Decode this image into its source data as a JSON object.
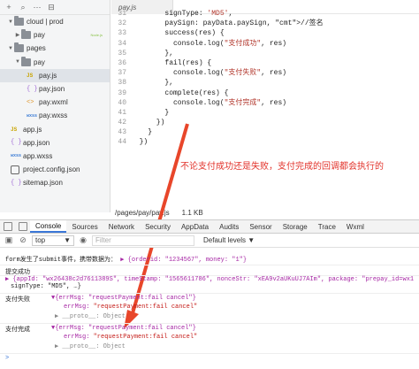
{
  "sidebar": {
    "items": [
      {
        "label": "cloud | prod",
        "kind": "folder",
        "caret": "▼",
        "indent": 8
      },
      {
        "label": "pay",
        "kind": "folder",
        "caret": "▶",
        "indent": 16,
        "tag": "Node.js"
      },
      {
        "label": "pages",
        "kind": "folder",
        "caret": "▼",
        "indent": 8
      },
      {
        "label": "pay",
        "kind": "folder",
        "caret": "▼",
        "indent": 16
      },
      {
        "label": "pay.js",
        "kind": "js",
        "badge": "JS",
        "indent": 30,
        "selected": true
      },
      {
        "label": "pay.json",
        "kind": "json",
        "badge": "{ }",
        "indent": 30
      },
      {
        "label": "pay.wxml",
        "kind": "wxml",
        "badge": "<>",
        "indent": 30
      },
      {
        "label": "pay.wxss",
        "kind": "wxss",
        "badge": "wxss",
        "indent": 30
      },
      {
        "label": "app.js",
        "kind": "js",
        "badge": "JS",
        "indent": 12
      },
      {
        "label": "app.json",
        "kind": "json",
        "badge": "{ }",
        "indent": 12
      },
      {
        "label": "app.wxss",
        "kind": "wxss",
        "badge": "wxss",
        "indent": 12
      },
      {
        "label": "project.config.json",
        "kind": "cfg",
        "badge": "",
        "indent": 12
      },
      {
        "label": "sitemap.json",
        "kind": "json",
        "badge": "{ }",
        "indent": 12
      }
    ]
  },
  "editor": {
    "tab_label": "pay.js",
    "lines": [
      {
        "n": "31",
        "t": "        signType: 'MD5',"
      },
      {
        "n": "32",
        "t": "        paySign: payData.paySign, //签名"
      },
      {
        "n": "33",
        "t": "        success(res) {"
      },
      {
        "n": "34",
        "t": "          console.log(\"支付成功\", res)"
      },
      {
        "n": "35",
        "t": "        },"
      },
      {
        "n": "36",
        "t": "        fail(res) {"
      },
      {
        "n": "37",
        "t": "          console.log(\"支付失败\", res)"
      },
      {
        "n": "38",
        "t": "        },"
      },
      {
        "n": "39",
        "t": "        complete(res) {"
      },
      {
        "n": "40",
        "t": "          console.log(\"支付完成\", res)"
      },
      {
        "n": "41",
        "t": "        }"
      },
      {
        "n": "42",
        "t": "      })"
      },
      {
        "n": "43",
        "t": "    }"
      },
      {
        "n": "44",
        "t": "  })"
      }
    ],
    "status_path": "/pages/pay/pay.js",
    "status_size": "1.1 KB"
  },
  "annotation": "不论支付成功还是失败，支付完成的回调都会执行的",
  "devtools": {
    "tabs": [
      "Console",
      "Sources",
      "Network",
      "Security",
      "AppData",
      "Audits",
      "Sensor",
      "Storage",
      "Trace",
      "Wxml"
    ],
    "active_tab": "Console",
    "context": "top",
    "filter_placeholder": "Filter",
    "levels": "Default levels ▼"
  },
  "console": {
    "line1_prefix": "form发生了submit事件，携带数据为：",
    "line1_obj": "▶ {orderid: \"1234567\", money: \"1\"}",
    "line2": "提交成功",
    "line3": "▶ {appId: \"wx26438c2d7611389S\", timeStamp: \"1565611786\", nonceStr: \"xEA9v2aUKuUJ7AIm\", package: \"prepay_id=wx1",
    "line4": "signType: \"MD5\", …}",
    "fail_label": "支付失败",
    "fail_obj": "▼{errMsg: \"requestPayment:fail cancel\"}",
    "fail_errmsg_key": "errMsg:",
    "fail_errmsg_val": "\"requestPayment:fail cancel\"",
    "fail_proto": "▶ __proto__: Object",
    "done_label": "支付完成",
    "done_obj": "▼{errMsg: \"requestPayment:fail cancel\"}",
    "done_errmsg_key": "errMsg:",
    "done_errmsg_val": "\"requestPayment:fail cancel\"",
    "done_proto": "▶ __proto__: Object",
    "prompt": ">"
  },
  "colors": {
    "annotation": "#e2322a",
    "arrow": "#e8462a",
    "accent": "#3c78d8"
  }
}
